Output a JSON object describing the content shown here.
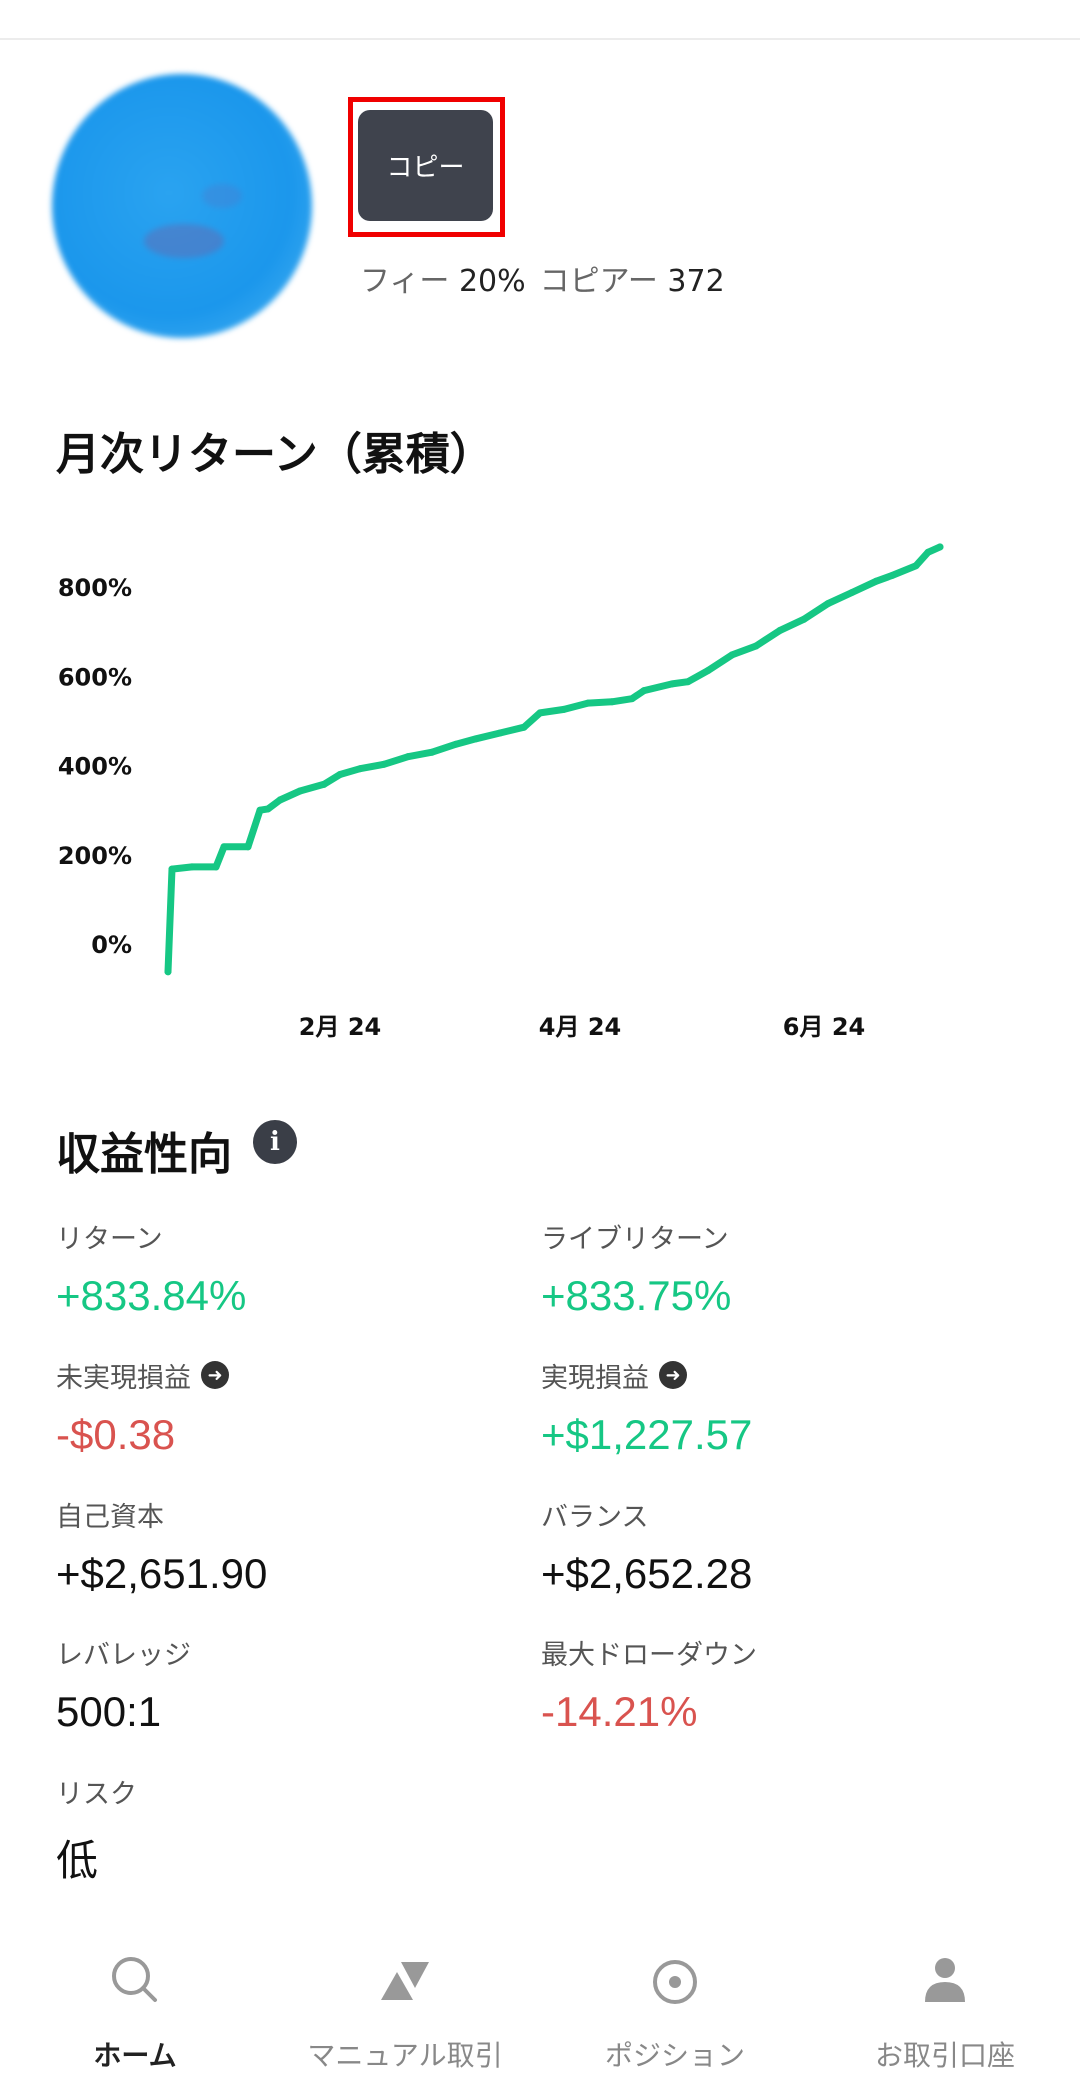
{
  "profile": {
    "copy_button_label": "コピー",
    "fee_label": "フィー",
    "fee_value": "20%",
    "copier_label": "コピアー",
    "copier_value": "372"
  },
  "chart_section": {
    "title": "月次リターン（累積）"
  },
  "chart_data": {
    "type": "line",
    "title": "月次リターン（累積）",
    "xlabel": "",
    "ylabel": "",
    "y_ticks": [
      "0%",
      "200%",
      "400%",
      "600%",
      "800%"
    ],
    "x_ticks": [
      "2月 24",
      "4月 24",
      "6月 24"
    ],
    "series": [
      {
        "color": "#16c784",
        "x": [
          "2023-12-20",
          "2023-12-21",
          "2023-12-26",
          "2024-01-01",
          "2024-01-03",
          "2024-01-09",
          "2024-01-12",
          "2024-01-14",
          "2024-01-17",
          "2024-01-22",
          "2024-01-28",
          "2024-02-01",
          "2024-02-06",
          "2024-02-12",
          "2024-02-18",
          "2024-02-24",
          "2024-03-01",
          "2024-03-06",
          "2024-03-12",
          "2024-03-18",
          "2024-03-22",
          "2024-03-28",
          "2024-04-03",
          "2024-04-09",
          "2024-04-14",
          "2024-04-17",
          "2024-04-24",
          "2024-04-28",
          "2024-05-03",
          "2024-05-09",
          "2024-05-15",
          "2024-05-21",
          "2024-05-27",
          "2024-06-02",
          "2024-06-08",
          "2024-06-14",
          "2024-06-18",
          "2024-06-24",
          "2024-06-27",
          "2024-06-30"
        ],
        "y": [
          -60,
          170,
          175,
          175,
          220,
          220,
          302,
          305,
          325,
          345,
          360,
          382,
          395,
          405,
          422,
          432,
          450,
          462,
          475,
          488,
          520,
          528,
          542,
          545,
          552,
          570,
          585,
          590,
          615,
          650,
          670,
          705,
          730,
          765,
          790,
          815,
          828,
          850,
          880,
          892
        ]
      }
    ],
    "ylim": [
      -60,
      900
    ],
    "grid": false,
    "legend": "none"
  },
  "stats_section": {
    "title": "収益性向",
    "items": [
      {
        "label": "リターン",
        "value": "+833.84%",
        "color": "green"
      },
      {
        "label": "ライブリターン",
        "value": "+833.75%",
        "color": "green"
      },
      {
        "label": "未実現損益",
        "value": "-$0.38",
        "color": "red",
        "has_arrow": true
      },
      {
        "label": "実現損益",
        "value": "+$1,227.57",
        "color": "green",
        "has_arrow": true
      },
      {
        "label": "自己資本",
        "value": "+$2,651.90",
        "color": "dark"
      },
      {
        "label": "バランス",
        "value": "+$2,652.28",
        "color": "dark"
      },
      {
        "label": "レバレッジ",
        "value": "500:1",
        "color": "dark"
      },
      {
        "label": "最大ドローダウン",
        "value": "-14.21%",
        "color": "red"
      },
      {
        "label": "リスク",
        "value": "低",
        "color": "dark"
      }
    ]
  },
  "bottom_nav": {
    "items": [
      {
        "label": "ホーム",
        "icon": "search-icon",
        "active": true
      },
      {
        "label": "マニュアル取引",
        "icon": "triangles-icon",
        "active": false
      },
      {
        "label": "ポジション",
        "icon": "target-icon",
        "active": false
      },
      {
        "label": "お取引口座",
        "icon": "person-icon",
        "active": false
      }
    ]
  }
}
